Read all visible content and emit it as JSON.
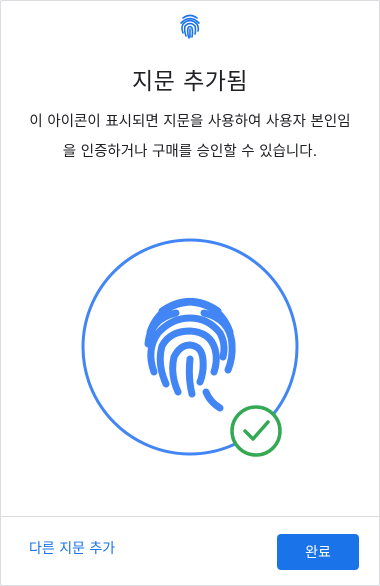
{
  "header": {
    "icon": "fingerprint-icon"
  },
  "main": {
    "title": "지문 추가됨",
    "description": "이 아이콘이 표시되면 지문을 사용하여 사용자 본인임을 인증하거나 구매를 승인할 수 있습니다.",
    "illustration": {
      "icons": [
        "fingerprint-icon",
        "check-circle-icon"
      ],
      "colors": {
        "accent": "#4285f4",
        "success": "#34a853"
      }
    }
  },
  "footer": {
    "add_another_label": "다른 지문 추가",
    "done_label": "완료"
  },
  "colors": {
    "primary": "#1a73e8",
    "divider": "#dadce0"
  }
}
